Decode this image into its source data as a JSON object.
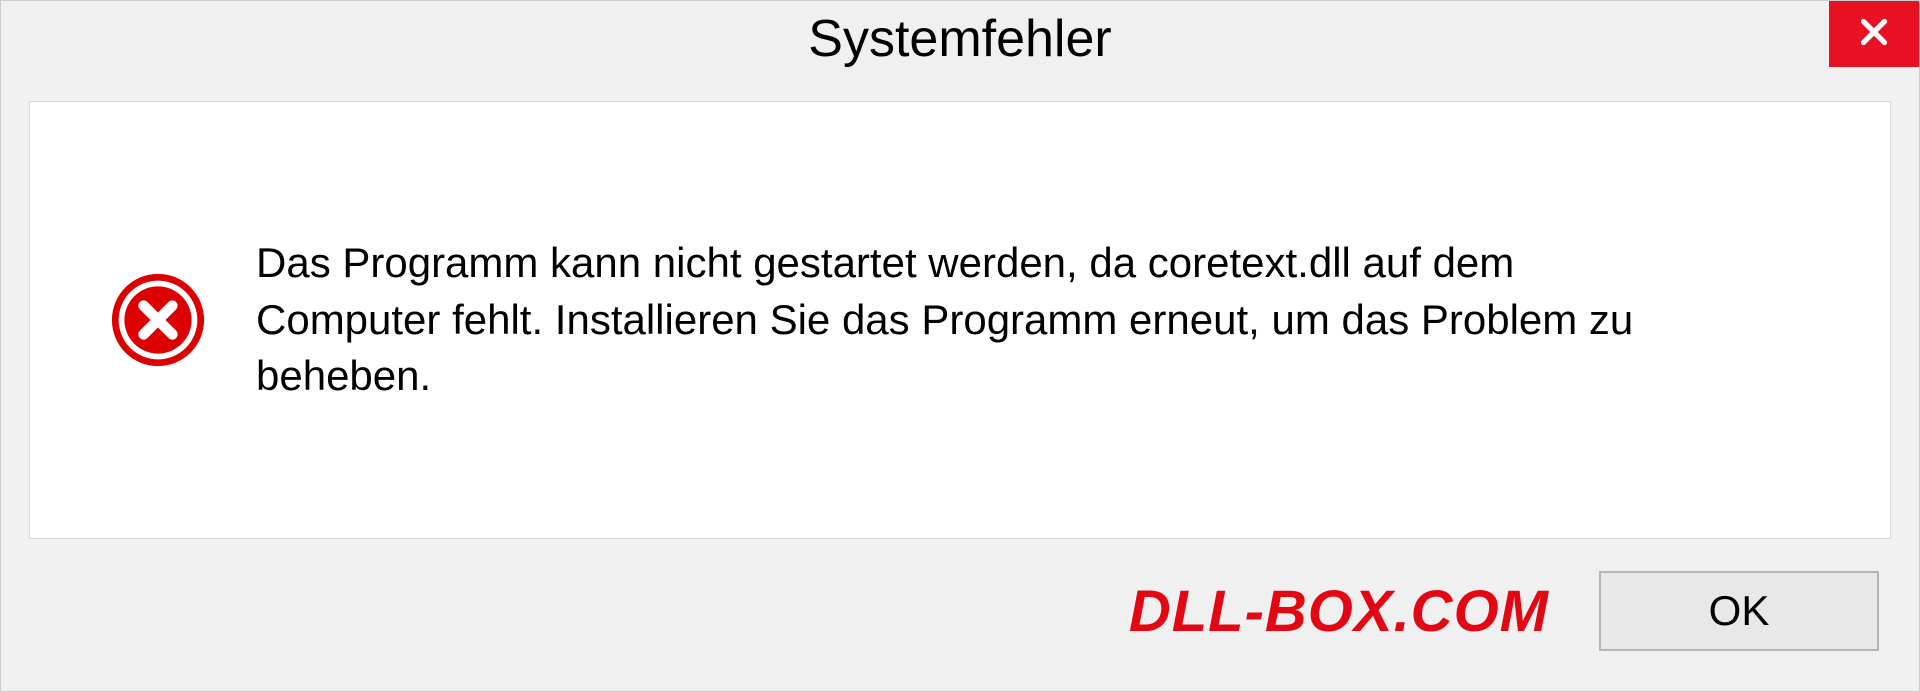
{
  "dialog": {
    "title": "Systemfehler",
    "message": "Das Programm kann nicht gestartet werden, da coretext.dll auf dem Computer fehlt. Installieren Sie das Programm erneut, um das Problem zu beheben.",
    "ok_label": "OK"
  },
  "watermark": "DLL-BOX.COM",
  "colors": {
    "close_bg": "#e81123",
    "error_red": "#dc0000",
    "watermark_red": "#e30613"
  }
}
